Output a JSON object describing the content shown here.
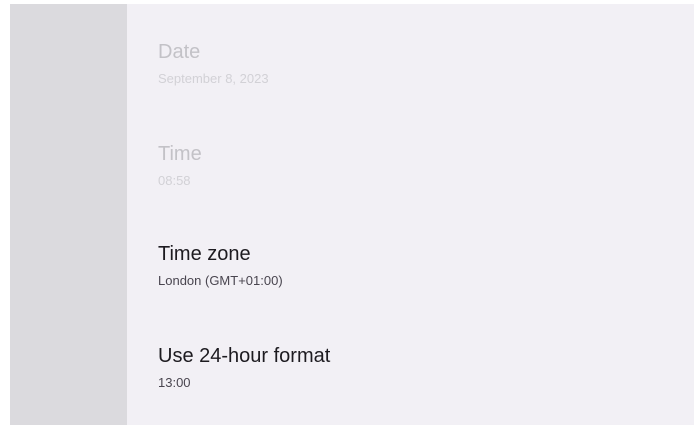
{
  "settings": {
    "items": [
      {
        "title": "Date",
        "summary": "September 8, 2023",
        "enabled": false
      },
      {
        "title": "Time",
        "summary": "08:58",
        "enabled": false
      },
      {
        "title": "Time zone",
        "summary": "London (GMT+01:00)",
        "enabled": true
      },
      {
        "title": "Use 24-hour format",
        "summary": "13:00",
        "enabled": true
      }
    ]
  }
}
